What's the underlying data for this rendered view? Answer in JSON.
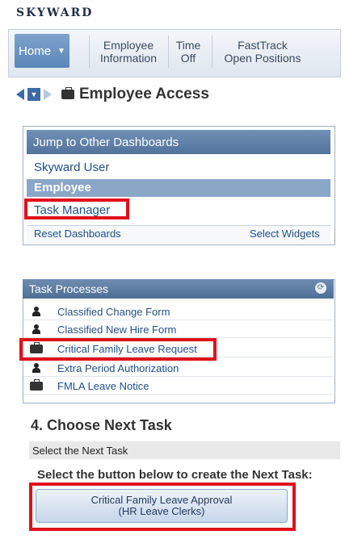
{
  "logo": {
    "text": "SKYWARD"
  },
  "nav": {
    "home": "Home",
    "items": [
      {
        "line1": "Employee",
        "line2": "Information"
      },
      {
        "line1": "Time",
        "line2": "Off"
      },
      {
        "line1": "FastTrack",
        "line2": "Open Positions"
      }
    ]
  },
  "breadcrumb": {
    "title": "Employee Access"
  },
  "dashboards": {
    "header": "Jump to Other Dashboards",
    "items": [
      "Skyward User",
      "Employee",
      "Task Manager"
    ],
    "reset": "Reset Dashboards",
    "select_widgets": "Select Widgets"
  },
  "task_processes": {
    "header": "Task Processes",
    "rows": [
      {
        "icon": "person-icon",
        "label": "Classified Change Form"
      },
      {
        "icon": "person-icon",
        "label": "Classified New Hire Form"
      },
      {
        "icon": "briefcase-icon",
        "label": "Critical Family Leave Request"
      },
      {
        "icon": "person-icon",
        "label": "Extra Period Authorization"
      },
      {
        "icon": "briefcase-icon",
        "label": "FMLA Leave Notice"
      }
    ]
  },
  "next_task": {
    "heading": "4.  Choose Next Task",
    "bar": "Select the Next Task",
    "instruction": "Select the button below to create the Next Task:",
    "button_line1": "Critical Family Leave Approval",
    "button_line2": "(HR Leave Clerks)"
  },
  "colors": {
    "highlight": "#e0111b",
    "link": "#1f4f86",
    "header": "#52739b"
  }
}
